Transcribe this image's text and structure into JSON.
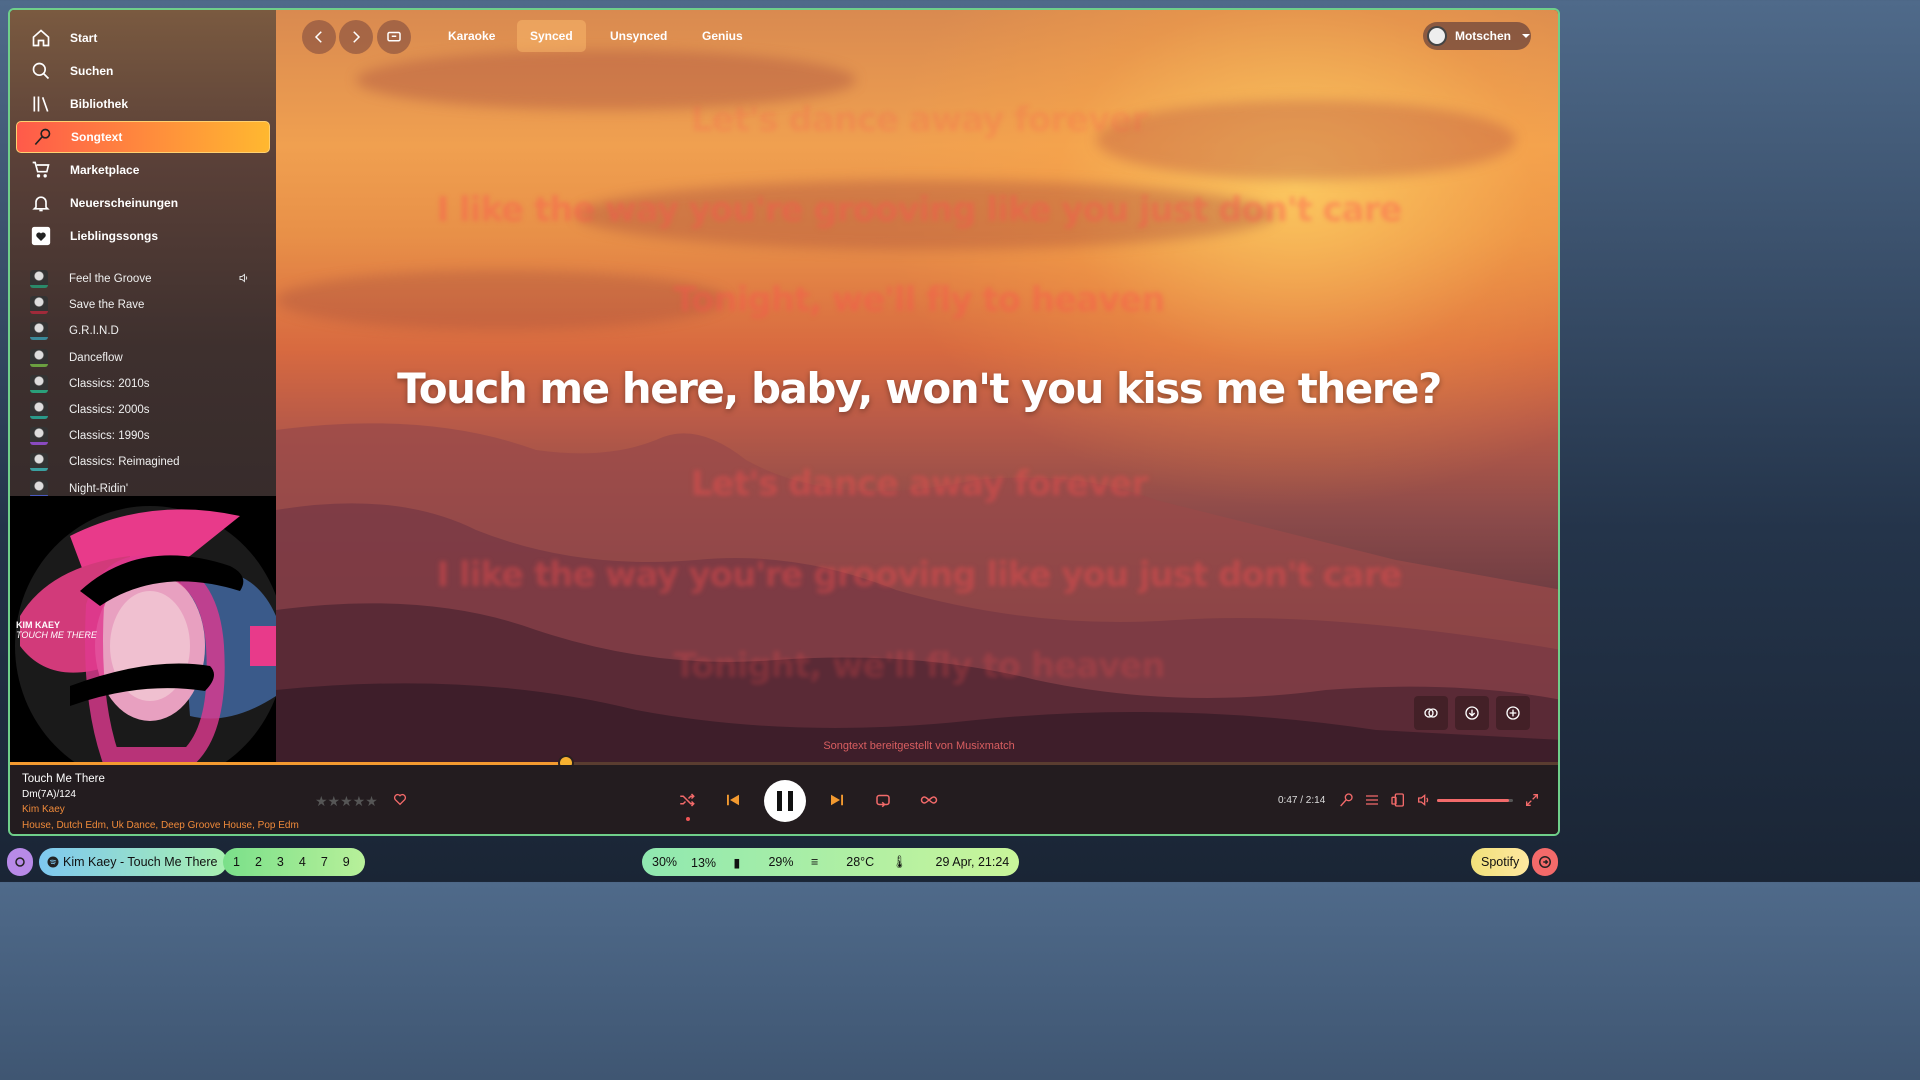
{
  "nav": {
    "items": [
      {
        "label": "Start",
        "icon": "home-icon"
      },
      {
        "label": "Suchen",
        "icon": "search-icon"
      },
      {
        "label": "Bibliothek",
        "icon": "library-icon"
      },
      {
        "label": "Songtext",
        "icon": "microphone-icon",
        "active": true
      },
      {
        "label": "Marketplace",
        "icon": "cart-icon"
      },
      {
        "label": "Neuerscheinungen",
        "icon": "bell-icon"
      },
      {
        "label": "Lieblingssongs",
        "icon": "heart-icon"
      }
    ]
  },
  "playlists": [
    {
      "label": "Feel the Groove",
      "playing": true
    },
    {
      "label": "Save the Rave"
    },
    {
      "label": "G.R.I.N.D"
    },
    {
      "label": "Danceflow"
    },
    {
      "label": "Classics: 2010s"
    },
    {
      "label": "Classics: 2000s"
    },
    {
      "label": "Classics: 1990s"
    },
    {
      "label": "Classics: Reimagined"
    },
    {
      "label": "Night-Ridin'"
    }
  ],
  "cover": {
    "artist": "KIM KAEY",
    "title": "TOUCH ME THERE"
  },
  "topbar": {
    "tabs": [
      "Karaoke",
      "Synced",
      "Unsynced",
      "Genius"
    ],
    "active_tab": "Synced",
    "user": "Motschen"
  },
  "lyrics": {
    "lines": [
      "Let's dance away forever",
      "I like the way you're grooving like you just don't care",
      "Tonight, we'll fly to heaven",
      "Touch me here, baby, won't you kiss me there?",
      "Let's dance away forever",
      "I like the way you're grooving like you just don't care",
      "Tonight, we'll fly to heaven"
    ],
    "current_index": 3,
    "credit": "Songtext bereitgestellt von Musixmatch"
  },
  "player": {
    "title": "Touch Me There",
    "key": "Dm(7A)/124",
    "artist": "Kim Kaey",
    "genres": "House, Dutch Edm, Uk Dance, Deep Groove House, Pop Edm",
    "time": "0:47 / 2:14",
    "progress": 0.358,
    "volume": 0.95,
    "rating": 0
  },
  "taskbar": {
    "window_title": "Kim Kaey - Touch Me There",
    "workspaces": [
      "1",
      "2",
      "3",
      "4",
      "7",
      "9"
    ],
    "status": {
      "volume": "30%",
      "battery": "13%",
      "memory": "29%",
      "temp": "28°C",
      "datetime": "29 Apr, 21:24"
    },
    "app": "Spotify"
  },
  "colors": {
    "accent": "#f39a30",
    "active_nav_start": "#ff5a4a",
    "active_nav_end": "#ffb830",
    "taskbar_green": "#8fe8b0"
  }
}
